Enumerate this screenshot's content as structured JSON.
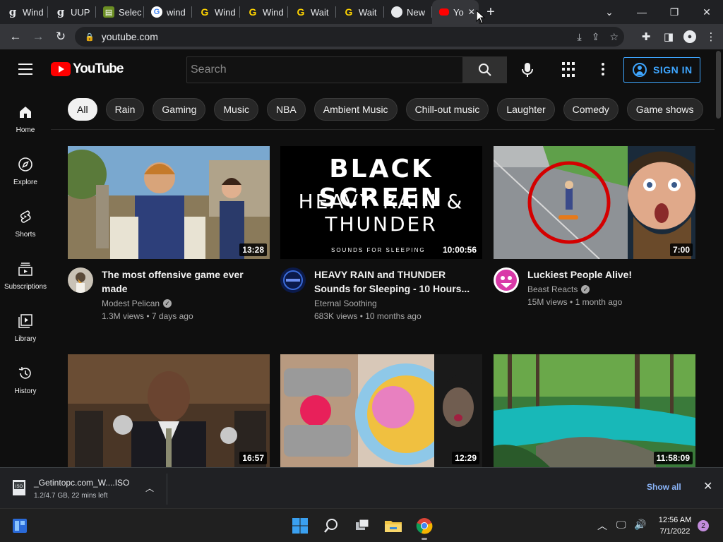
{
  "browser": {
    "tabs": [
      {
        "label": "Wind",
        "favicon": "g-letter-icon"
      },
      {
        "label": "UUP",
        "favicon": "g-letter-icon"
      },
      {
        "label": "Selec",
        "favicon": "site-icon"
      },
      {
        "label": "wind",
        "favicon": "google-icon"
      },
      {
        "label": "Wind",
        "favicon": "g-yellow-icon"
      },
      {
        "label": "Wind",
        "favicon": "g-yellow-icon"
      },
      {
        "label": "Wait",
        "favicon": "g-yellow-icon"
      },
      {
        "label": "Wait",
        "favicon": "g-yellow-icon"
      },
      {
        "label": "New",
        "favicon": "chrome-icon"
      },
      {
        "label": "Yo",
        "favicon": "youtube-icon",
        "active": true
      }
    ],
    "url": "youtube.com"
  },
  "header": {
    "logo_text": "YouTube",
    "search_placeholder": "Search",
    "sign_in_label": "SIGN IN",
    "accent_color": "#3ea6ff"
  },
  "sidebar": {
    "items": [
      {
        "label": "Home",
        "icon": "home-icon"
      },
      {
        "label": "Explore",
        "icon": "compass-icon"
      },
      {
        "label": "Shorts",
        "icon": "shorts-icon"
      },
      {
        "label": "Subscriptions",
        "icon": "subscriptions-icon"
      },
      {
        "label": "Library",
        "icon": "library-icon"
      },
      {
        "label": "History",
        "icon": "history-icon"
      }
    ]
  },
  "chips": [
    "All",
    "Rain",
    "Gaming",
    "Music",
    "NBA",
    "Ambient Music",
    "Chill-out music",
    "Laughter",
    "Comedy",
    "Game shows"
  ],
  "videos": [
    {
      "title": "The most offensive game ever made",
      "channel": "Modest Pelican",
      "verified": true,
      "views": "1.3M views",
      "age": "7 days ago",
      "duration": "13:28"
    },
    {
      "title": "HEAVY RAIN and THUNDER Sounds for Sleeping - 10 Hours...",
      "channel": "Eternal Soothing",
      "verified": false,
      "views": "683K views",
      "age": "10 months ago",
      "duration": "10:00:56"
    },
    {
      "title": "Luckiest People Alive!",
      "channel": "Beast Reacts",
      "verified": true,
      "views": "15M views",
      "age": "1 month ago",
      "duration": "7:00"
    },
    {
      "duration": "16:57"
    },
    {
      "duration": "12:29"
    },
    {
      "duration": "11:58:09"
    }
  ],
  "thumb_text": {
    "black_screen_line1": "BLACK SCREEN",
    "black_screen_line2": "HEAVY RAIN &",
    "black_screen_line3": "THUNDER",
    "black_screen_line4": "SOUNDS FOR SLEEPING"
  },
  "downloads": {
    "filename": "_Getintopc.com_W....ISO",
    "status": "1.2/4.7 GB, 22 mins left",
    "show_all_label": "Show all"
  },
  "taskbar": {
    "time": "12:56 AM",
    "date": "7/1/2022",
    "notifications": "2"
  }
}
